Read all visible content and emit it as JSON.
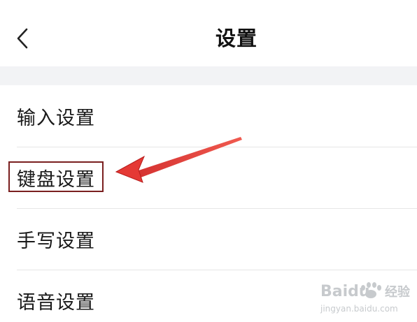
{
  "header": {
    "title": "设置"
  },
  "settings": {
    "items": [
      {
        "label": "输入设置"
      },
      {
        "label": "键盘设置"
      },
      {
        "label": "手写设置"
      },
      {
        "label": "语音设置"
      }
    ]
  },
  "annotation": {
    "highlight_color": "#7a1f1f",
    "arrow_color": "#e53935"
  },
  "watermark": {
    "brand": "Baidu",
    "brand_cn": "经验",
    "url": "jingyan.baidu.com"
  }
}
